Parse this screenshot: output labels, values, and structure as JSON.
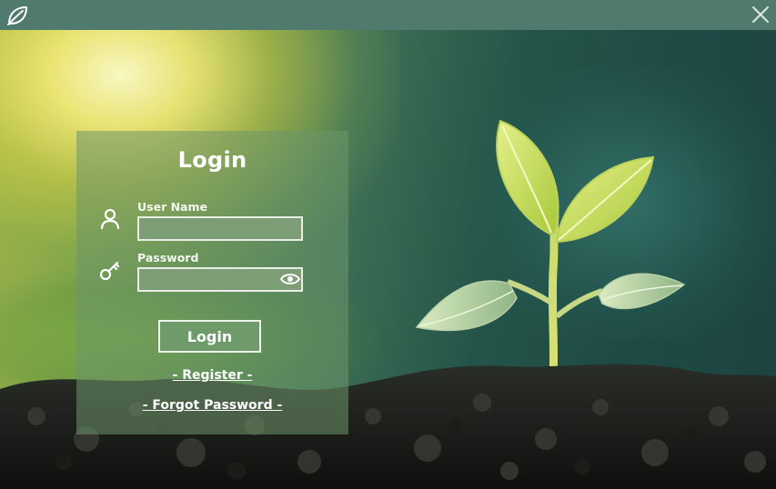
{
  "window": {
    "titlebar_color": "#4f7a6d",
    "app_icon": "leaf-icon",
    "close_icon": "close-icon"
  },
  "login": {
    "title": "Login",
    "username": {
      "label": "User Name",
      "value": "",
      "icon": "user-icon"
    },
    "password": {
      "label": "Password",
      "value": "",
      "icon": "key-icon",
      "toggle_icon": "eye-icon"
    },
    "submit_label": "Login",
    "register_link": "- Register -",
    "forgot_link": "- Forgot Password -"
  },
  "colors": {
    "panel": "rgba(110,150,105,0.55)",
    "input_bg": "#7d9d77",
    "button_bg": "#6f9a6a",
    "text": "#ffffff"
  }
}
